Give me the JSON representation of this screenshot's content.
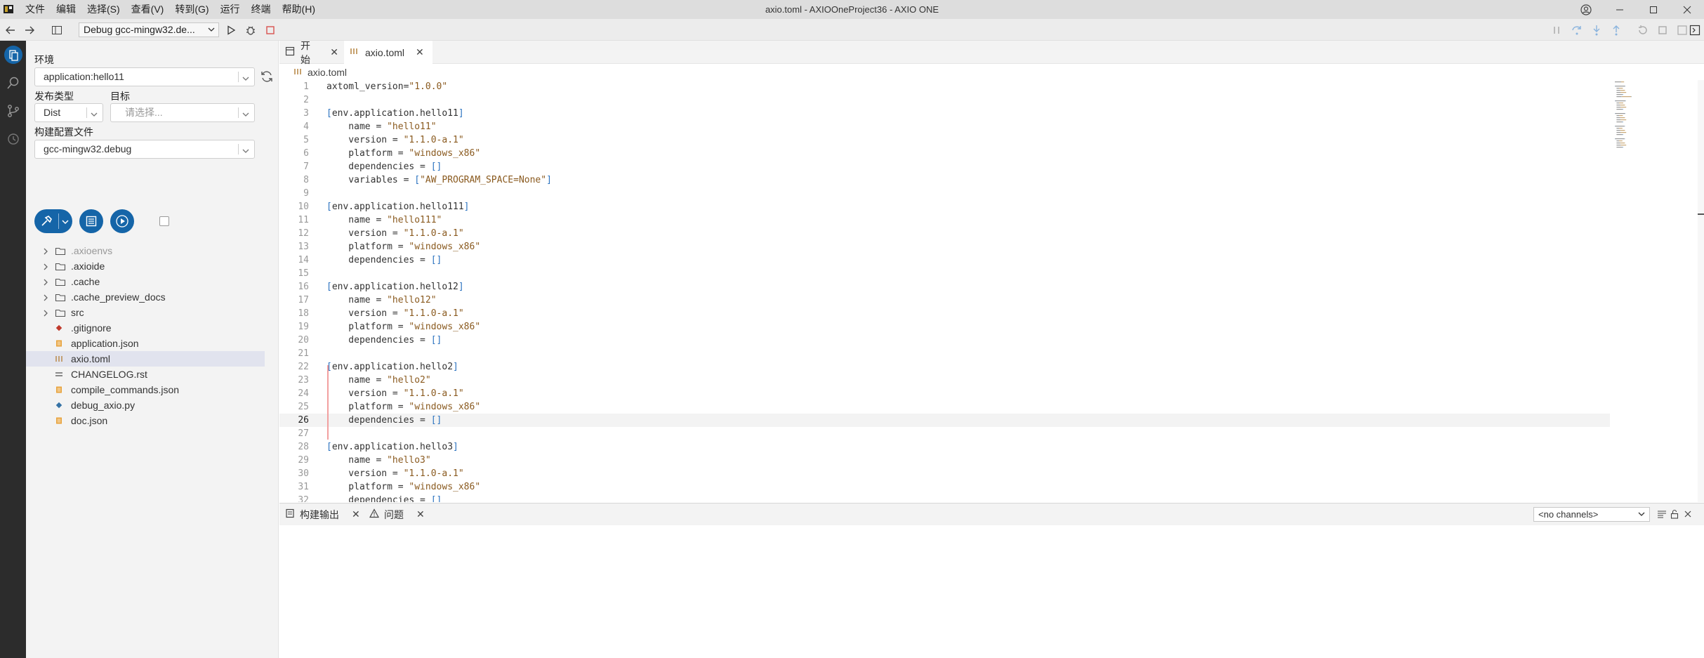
{
  "window": {
    "title": "axio.toml - AXIOOneProject36 - AXIO ONE",
    "menu": [
      "文件",
      "编辑",
      "选择(S)",
      "查看(V)",
      "转到(G)",
      "运行",
      "终端",
      "帮助(H)"
    ]
  },
  "toolbar": {
    "debug_config": "Debug gcc-mingw32.de..."
  },
  "side": {
    "env_label": "环境",
    "env_value": "application:hello11",
    "release_type_label": "发布类型",
    "release_type_value": "Dist",
    "target_label": "目标",
    "target_placeholder": "请选择...",
    "build_config_label": "构建配置文件",
    "build_config_value": "gcc-mingw32.debug"
  },
  "tree": [
    {
      "name": ".axioenvs",
      "type": "folder",
      "dim": true
    },
    {
      "name": ".axioide",
      "type": "folder"
    },
    {
      "name": ".cache",
      "type": "folder"
    },
    {
      "name": ".cache_preview_docs",
      "type": "folder"
    },
    {
      "name": "src",
      "type": "folder"
    },
    {
      "name": ".gitignore",
      "type": "git"
    },
    {
      "name": "application.json",
      "type": "json"
    },
    {
      "name": "axio.toml",
      "type": "toml",
      "selected": true
    },
    {
      "name": "CHANGELOG.rst",
      "type": "rst"
    },
    {
      "name": "compile_commands.json",
      "type": "json"
    },
    {
      "name": "debug_axio.py",
      "type": "py"
    },
    {
      "name": "doc.json",
      "type": "json"
    }
  ],
  "editor": {
    "tabs": [
      {
        "label": "开始",
        "active": false
      },
      {
        "label": "axio.toml",
        "active": true
      }
    ],
    "breadcrumb": "axio.toml",
    "current_line": 26,
    "lines": [
      [
        [
          "axtoml_version=",
          ""
        ],
        [
          "\"1.0.0\"",
          "str"
        ]
      ],
      [],
      [
        [
          "[",
          "br"
        ],
        [
          "env.application.hello11",
          ""
        ],
        [
          "]",
          "br"
        ]
      ],
      [
        [
          "    name = ",
          ""
        ],
        [
          "\"hello11\"",
          "str"
        ]
      ],
      [
        [
          "    version = ",
          ""
        ],
        [
          "\"1.1.0-a.1\"",
          "str"
        ]
      ],
      [
        [
          "    platform = ",
          ""
        ],
        [
          "\"windows_x86\"",
          "str"
        ]
      ],
      [
        [
          "    dependencies = ",
          ""
        ],
        [
          "[]",
          "br"
        ]
      ],
      [
        [
          "    variables = ",
          ""
        ],
        [
          "[",
          "br"
        ],
        [
          "\"AW_PROGRAM_SPACE=None\"",
          "str"
        ],
        [
          "]",
          "br"
        ]
      ],
      [],
      [
        [
          "[",
          "br"
        ],
        [
          "env.application.hello111",
          ""
        ],
        [
          "]",
          "br"
        ]
      ],
      [
        [
          "    name = ",
          ""
        ],
        [
          "\"hello111\"",
          "str"
        ]
      ],
      [
        [
          "    version = ",
          ""
        ],
        [
          "\"1.1.0-a.1\"",
          "str"
        ]
      ],
      [
        [
          "    platform = ",
          ""
        ],
        [
          "\"windows_x86\"",
          "str"
        ]
      ],
      [
        [
          "    dependencies = ",
          ""
        ],
        [
          "[]",
          "br"
        ]
      ],
      [],
      [
        [
          "[",
          "br"
        ],
        [
          "env.application.hello12",
          ""
        ],
        [
          "]",
          "br"
        ]
      ],
      [
        [
          "    name = ",
          ""
        ],
        [
          "\"hello12\"",
          "str"
        ]
      ],
      [
        [
          "    version = ",
          ""
        ],
        [
          "\"1.1.0-a.1\"",
          "str"
        ]
      ],
      [
        [
          "    platform = ",
          ""
        ],
        [
          "\"windows_x86\"",
          "str"
        ]
      ],
      [
        [
          "    dependencies = ",
          ""
        ],
        [
          "[]",
          "br"
        ]
      ],
      [],
      [
        [
          "[",
          "br"
        ],
        [
          "env.application.hello2",
          ""
        ],
        [
          "]",
          "br"
        ]
      ],
      [
        [
          "    name = ",
          ""
        ],
        [
          "\"hello2\"",
          "str"
        ]
      ],
      [
        [
          "    version = ",
          ""
        ],
        [
          "\"1.1.0-a.1\"",
          "str"
        ]
      ],
      [
        [
          "    platform = ",
          ""
        ],
        [
          "\"windows_x86\"",
          "str"
        ]
      ],
      [
        [
          "    dependencies = ",
          ""
        ],
        [
          "[]",
          "br"
        ]
      ],
      [],
      [
        [
          "[",
          "br"
        ],
        [
          "env.application.hello3",
          ""
        ],
        [
          "]",
          "br"
        ]
      ],
      [
        [
          "    name = ",
          ""
        ],
        [
          "\"hello3\"",
          "str"
        ]
      ],
      [
        [
          "    version = ",
          ""
        ],
        [
          "\"1.1.0-a.1\"",
          "str"
        ]
      ],
      [
        [
          "    platform = ",
          ""
        ],
        [
          "\"windows_x86\"",
          "str"
        ]
      ],
      [
        [
          "    dependencies = ",
          ""
        ],
        [
          "[]",
          "br"
        ]
      ]
    ]
  },
  "panel": {
    "tab_build_output": "构建输出",
    "tab_problems": "问题",
    "channel": "<no channels>"
  },
  "colors": {
    "accent": "#1565a8",
    "activity_bar": "#2c2c2c",
    "string": "#8a5a1f",
    "bracket": "#2c73c0"
  }
}
